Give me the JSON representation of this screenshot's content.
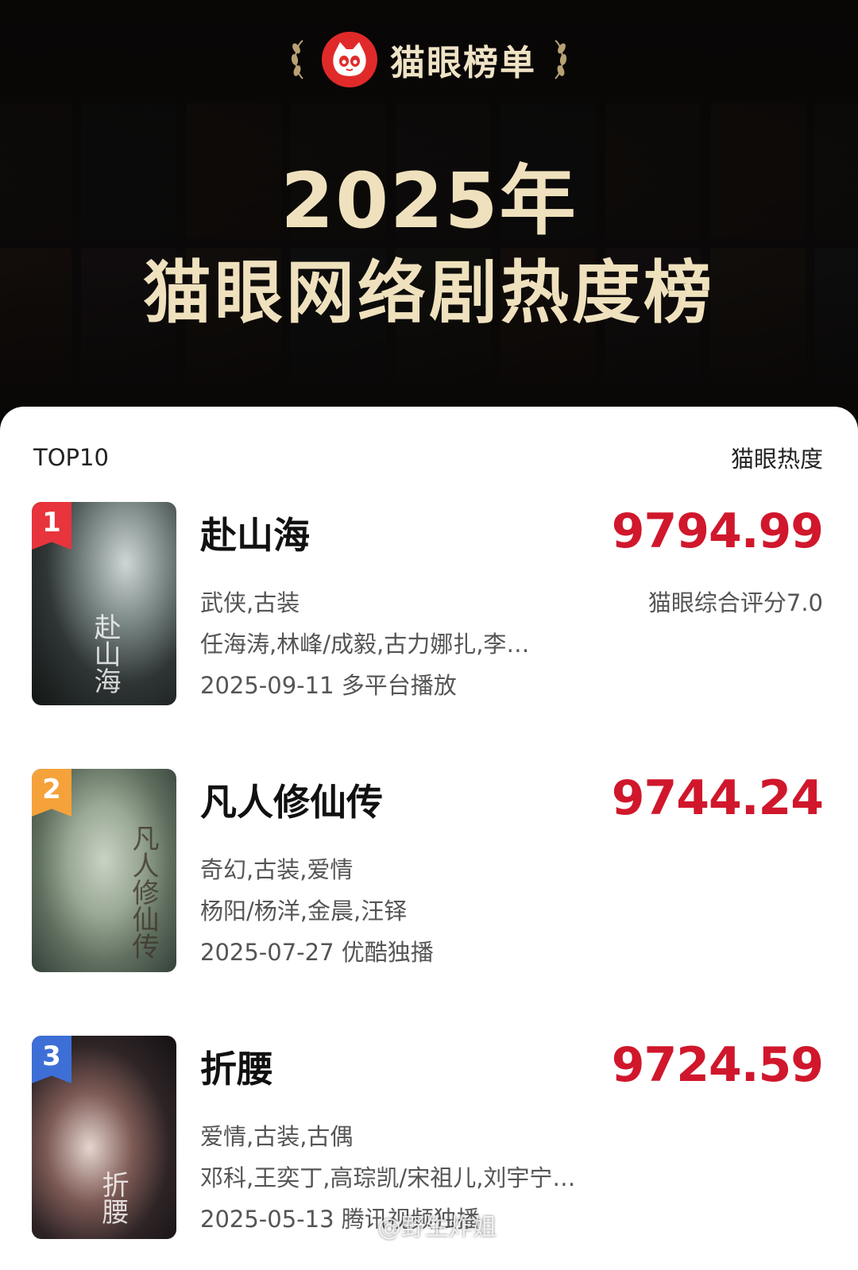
{
  "header": {
    "brand": "猫眼榜单",
    "year": "2025年",
    "title": "猫眼网络剧热度榜"
  },
  "list": {
    "label_left": "TOP10",
    "label_right": "猫眼热度",
    "items": [
      {
        "rank": "1",
        "title": "赴山海",
        "score": "9794.99",
        "sub_score": "猫眼综合评分7.0",
        "genres": "武侠,古装",
        "cast": "任海涛,林峰/成毅,古力娜扎,李…",
        "release": "2025-09-11 多平台播放",
        "poster_text": "赴山海"
      },
      {
        "rank": "2",
        "title": "凡人修仙传",
        "score": "9744.24",
        "genres": "奇幻,古装,爱情",
        "cast": "杨阳/杨洋,金晨,汪铎",
        "release": "2025-07-27 优酷独播",
        "poster_text": "凡人修仙传"
      },
      {
        "rank": "3",
        "title": "折腰",
        "score": "9724.59",
        "genres": "爱情,古装,古偶",
        "cast": "邓科,王奕丁,高琮凯/宋祖儿,刘宇宁…",
        "release": "2025-05-13 腾讯视频独播",
        "poster_text": "折腰"
      }
    ]
  },
  "watermark": "@野生炸姐",
  "colors": {
    "score_red": "#d0172c",
    "rank1": "#e8343c",
    "rank2": "#f5a23a",
    "rank3": "#3d6fd6",
    "gold_text": "#efe1bd",
    "brand_red": "#e02a2a"
  },
  "icons": [
    "cat-logo-icon",
    "laurel-left-icon",
    "laurel-right-icon"
  ]
}
